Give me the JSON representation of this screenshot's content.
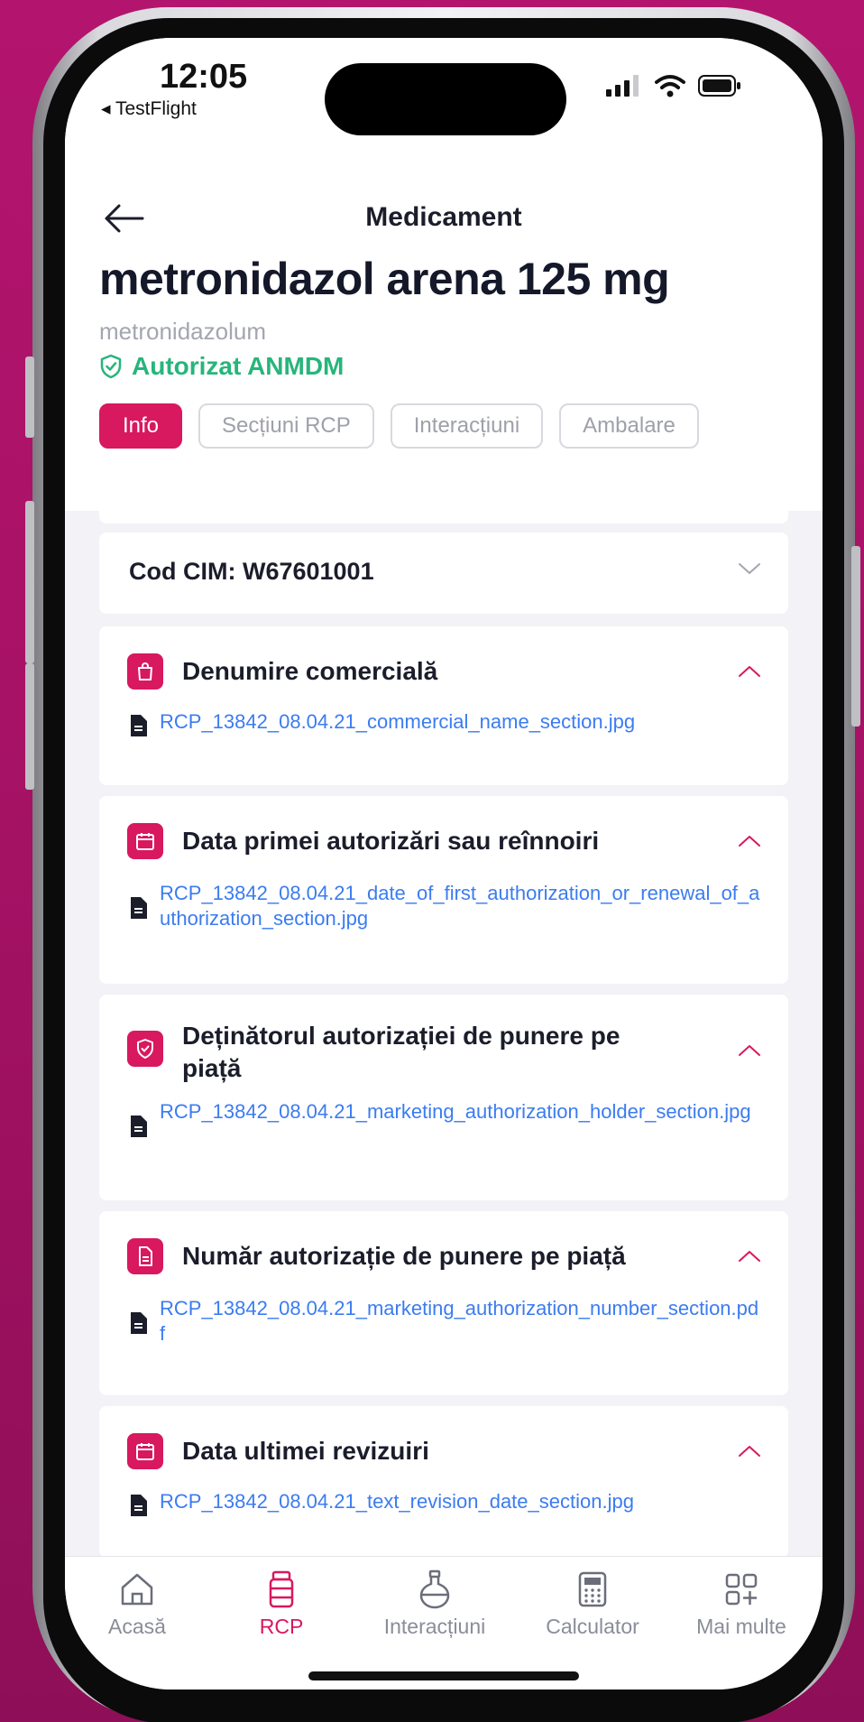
{
  "status_bar": {
    "time": "12:05",
    "back_app": "◂ TestFlight"
  },
  "header": {
    "nav_title": "Medicament",
    "drug_name": "metronidazol arena 125 mg",
    "substance": "metronidazolum",
    "authorization": "Autorizat ANMDM"
  },
  "tabs": [
    {
      "label": "Info",
      "active": true
    },
    {
      "label": "Secțiuni RCP",
      "active": false
    },
    {
      "label": "Interacțiuni",
      "active": false
    },
    {
      "label": "Ambalare",
      "active": false
    }
  ],
  "cim": {
    "label": "Cod CIM: W67601001"
  },
  "sections": [
    {
      "icon": "shopping-bag-icon",
      "title": "Denumire comercială",
      "file": "RCP_13842_08.04.21_commercial_name_section.jpg"
    },
    {
      "icon": "calendar-icon",
      "title": "Data primei autorizări sau reînnoiri",
      "file": "RCP_13842_08.04.21_date_of_first_authorization_or_renewal_of_authorization_section.jpg"
    },
    {
      "icon": "shield-check-icon",
      "title": "Deținătorul autorizației de punere pe piață",
      "file": "RCP_13842_08.04.21_marketing_authorization_holder_section.jpg"
    },
    {
      "icon": "document-icon",
      "title": "Număr autorizație de punere pe piață",
      "file": "RCP_13842_08.04.21_marketing_authorization_number_section.pdf"
    },
    {
      "icon": "calendar-icon",
      "title": "Data ultimei revizuiri",
      "file": "RCP_13842_08.04.21_text_revision_date_section.jpg"
    }
  ],
  "bottom_nav": [
    {
      "icon": "home-icon",
      "label": "Acasă",
      "active": false
    },
    {
      "icon": "pill-bottle-icon",
      "label": "RCP",
      "active": true
    },
    {
      "icon": "flask-icon",
      "label": "Interacțiuni",
      "active": false
    },
    {
      "icon": "calculator-icon",
      "label": "Calculator",
      "active": false
    },
    {
      "icon": "grid-plus-icon",
      "label": "Mai multe",
      "active": false
    }
  ],
  "colors": {
    "accent": "#d8185f",
    "success": "#27b57b",
    "link": "#3b7cf0",
    "background": "#b3146e"
  }
}
